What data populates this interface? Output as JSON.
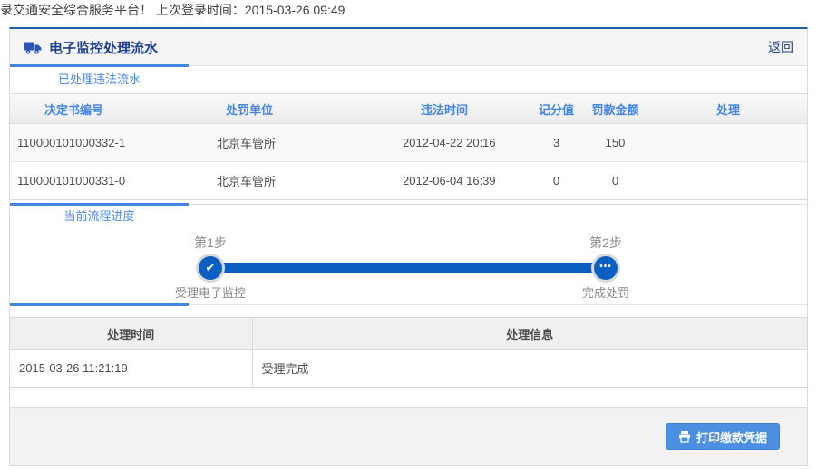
{
  "top_bar": {
    "welcome_text": "录交通安全综合服务平台！ 上次登录时间：2015-03-26 09:49"
  },
  "panel": {
    "title": "电子监控处理流水",
    "back_label": "返回",
    "tabs": {
      "processed": "已处理违法流水",
      "progress": "当前流程进度"
    },
    "violations_table": {
      "headers": [
        "决定书编号",
        "处罚单位",
        "违法时间",
        "记分值",
        "罚款金额",
        "处理"
      ],
      "rows": [
        {
          "decision_no": "110000101000332-1",
          "unit": "北京车管所",
          "time": "2012-04-22 20:16",
          "points": "3",
          "fine": "150",
          "action": ""
        },
        {
          "decision_no": "110000101000331-0",
          "unit": "北京车管所",
          "time": "2012-06-04 16:39",
          "points": "0",
          "fine": "0",
          "action": ""
        }
      ]
    },
    "progress_steps": {
      "steps": [
        {
          "step_label": "第1步",
          "name": "受理电子监控",
          "status": "done",
          "glyph": "✔"
        },
        {
          "step_label": "第2步",
          "name": "完成处罚",
          "status": "pending",
          "glyph": "•••"
        }
      ]
    },
    "process_table": {
      "headers": [
        "处理时间",
        "处理信息"
      ],
      "rows": [
        {
          "time": "2015-03-26 11:21:19",
          "info": "受理完成"
        }
      ]
    },
    "footer": {
      "print_button_label": "打印缴款凭据"
    }
  },
  "icons": {
    "panel": "truck-icon",
    "print": "printer-icon",
    "step_done": "check-icon",
    "step_pending": "ellipsis-icon"
  },
  "colors": {
    "accent_blue": "#4484e4",
    "navy_title": "#1d3e8f",
    "progress_blue": "#0b5fc0",
    "button_blue": "#4a8fe2",
    "panel_top_border": "#1e5fa8"
  }
}
